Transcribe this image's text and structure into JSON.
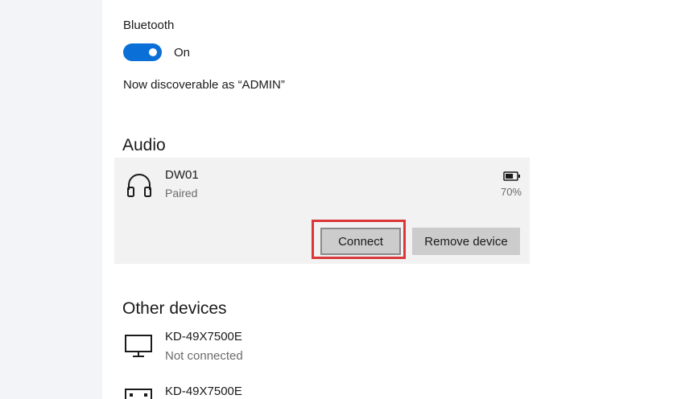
{
  "bluetooth": {
    "label": "Bluetooth",
    "toggle_state": "On",
    "discoverable_text": "Now discoverable as “ADMIN”"
  },
  "audio": {
    "section_title": "Audio",
    "device": {
      "name": "DW01",
      "status": "Paired",
      "icon": "headphones-icon",
      "battery_percent": "70%",
      "battery_level": 0.7,
      "connect_label": "Connect",
      "remove_label": "Remove device"
    }
  },
  "other_devices": {
    "section_title": "Other devices",
    "items": [
      {
        "name": "KD-49X7500E",
        "status": "Not connected",
        "icon": "monitor-icon"
      },
      {
        "name": "KD-49X7500E",
        "status": "",
        "icon": "tv-icon"
      }
    ]
  },
  "colors": {
    "accent": "#0a6fd6",
    "highlight": "#d9373a",
    "card_bg": "#f2f2f2",
    "button_bg": "#cccccc"
  }
}
